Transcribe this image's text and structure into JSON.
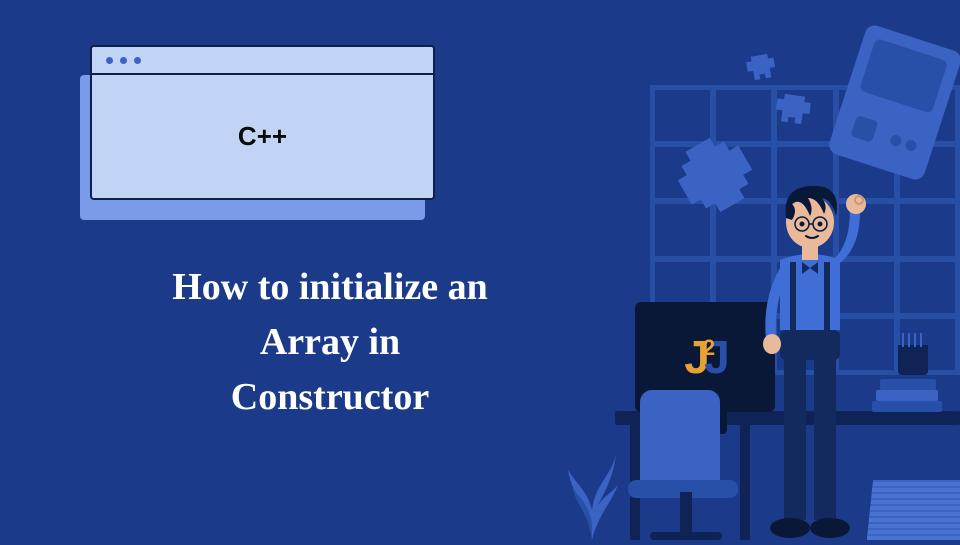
{
  "card": {
    "label": "C++"
  },
  "headline": {
    "line1": "How to initialize an",
    "line2": "Array in",
    "line3": "Constructor"
  },
  "logo": {
    "part1": "J",
    "part2": "2",
    "part3": "J"
  }
}
